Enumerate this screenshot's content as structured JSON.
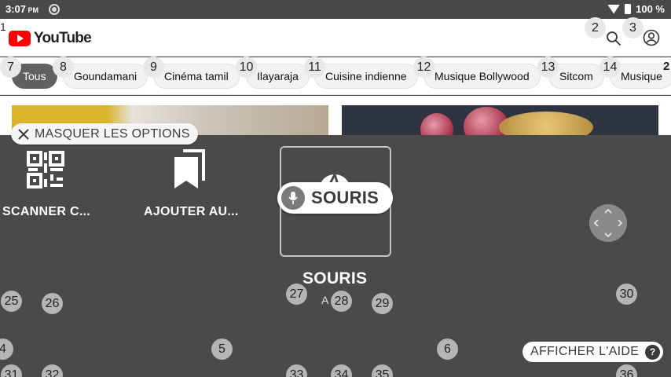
{
  "status_bar": {
    "time": "3:07",
    "ampm": "PM",
    "battery": "100 %"
  },
  "youtube": {
    "logo_text": "YouTube",
    "chips": [
      "Tous",
      "Goundamani",
      "Cinéma tamil",
      "Ilayaraja",
      "Cuisine indienne",
      "Musique Bollywood",
      "Sitcom",
      "Musique"
    ]
  },
  "overlay": {
    "hide_options_label": "MASQUER LES OPTIONS",
    "tiles": {
      "scanner_label": "SCANNER C...",
      "add_label": "AJOUTER AU...",
      "mouse_pill_label": "SOURIS",
      "mouse_label": "SOURIS",
      "mouse_sub": "A"
    },
    "help_label": "AFFICHER L'AIDE",
    "help_icon": "?"
  },
  "number_labels": {
    "n1": "1",
    "n2": "2",
    "n3": "3",
    "n4": "4",
    "n5": "5",
    "n6": "6",
    "n7": "7",
    "n8": "8",
    "n9": "9",
    "n10": "10",
    "n11": "11",
    "n12": "12",
    "n13": "13",
    "n14": "14",
    "n2b": "2",
    "n25": "25",
    "n26": "26",
    "n27": "27",
    "n28": "28",
    "n29": "29",
    "n30": "30",
    "n31": "31",
    "n32": "32",
    "n33": "33",
    "n34": "34",
    "n35": "35",
    "n36": "36"
  },
  "icons": [
    "notification-icon",
    "wifi-icon",
    "battery-icon",
    "youtube-play-icon",
    "search-icon",
    "account-icon",
    "close-icon",
    "qr-code-icon",
    "bookmark-add-icon",
    "mic-icon",
    "dpad-icon"
  ]
}
